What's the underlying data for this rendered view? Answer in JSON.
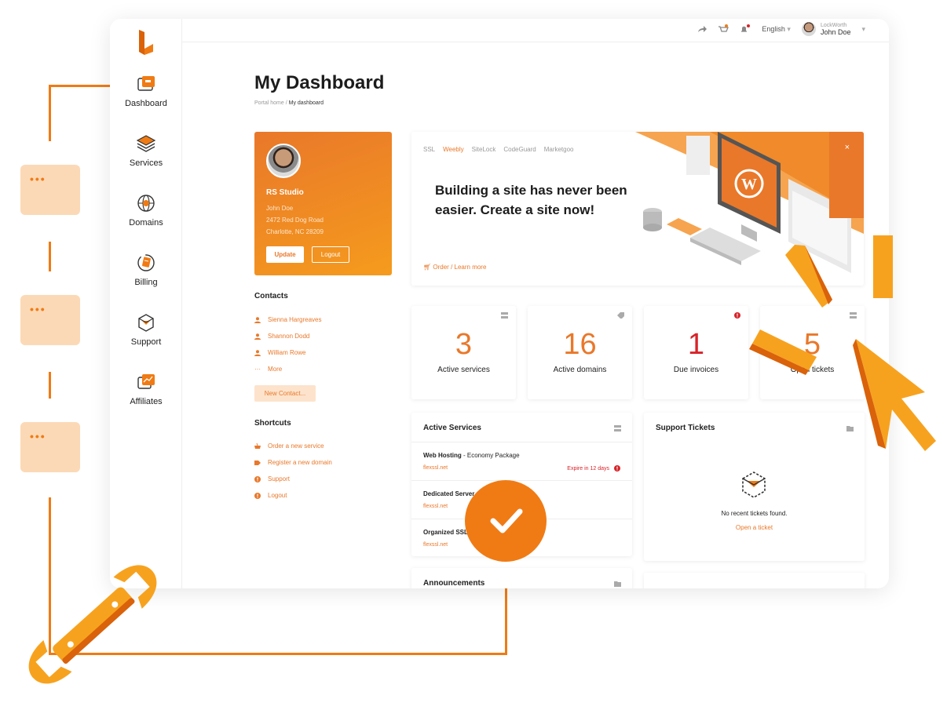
{
  "topbar": {
    "language": "English",
    "company": "LockWorth",
    "user": "John Doe"
  },
  "sidebar": {
    "items": [
      {
        "label": "Dashboard"
      },
      {
        "label": "Services"
      },
      {
        "label": "Domains"
      },
      {
        "label": "Billing"
      },
      {
        "label": "Support"
      },
      {
        "label": "Affiliates"
      }
    ]
  },
  "page": {
    "title": "My Dashboard",
    "breadcrumb_home": "Portal home",
    "breadcrumb_sep": "/",
    "breadcrumb_current": "My dashboard"
  },
  "profile": {
    "company": "RS Studio",
    "name": "John Doe",
    "address1": "2472 Red Dog Road",
    "address2": "Charlotte, NC 28209",
    "update_label": "Update",
    "logout_label": "Logout"
  },
  "contacts": {
    "heading": "Contacts",
    "items": [
      "Sienna Hargreaves",
      "Shannon Dodd",
      "William Rowe"
    ],
    "more_label": "More",
    "new_label": "New Contact..."
  },
  "shortcuts": {
    "heading": "Shortcuts",
    "items": [
      "Order a new service",
      "Register a new domain",
      "Support",
      "Logout"
    ]
  },
  "banner": {
    "tabs": [
      "SSL",
      "Weebly",
      "SiteLock",
      "CodeGuard",
      "Marketgoo"
    ],
    "active_tab": "Weebly",
    "headline": "Building a site has never been easier. Create a site now!",
    "cta": "Order / Learn more",
    "close": "×"
  },
  "stats": [
    {
      "value": "3",
      "label": "Active services"
    },
    {
      "value": "16",
      "label": "Active domains"
    },
    {
      "value": "1",
      "label": "Due invoices"
    },
    {
      "value": "5",
      "label": "Open tickets"
    }
  ],
  "active_services": {
    "heading": "Active Services",
    "rows": [
      {
        "name": "Web Hosting",
        "plan": " - Economy Package",
        "domain": "flexssl.net",
        "status": "Expire in 12 days"
      },
      {
        "name": "Dedicated Server",
        "plan": "",
        "domain": "flexssl.net",
        "status": ""
      },
      {
        "name": "Organized SSL",
        "plan": "",
        "domain": "flexssl.net",
        "status": ""
      }
    ]
  },
  "support_tickets": {
    "heading": "Support Tickets",
    "empty": "No recent tickets found.",
    "open_label": "Open a ticket"
  },
  "announcements": {
    "heading": "Announcements"
  },
  "colors": {
    "accent": "#e9782a",
    "accent_light": "#fde3cc",
    "danger": "#d8232a",
    "flow": "#f07b14"
  }
}
